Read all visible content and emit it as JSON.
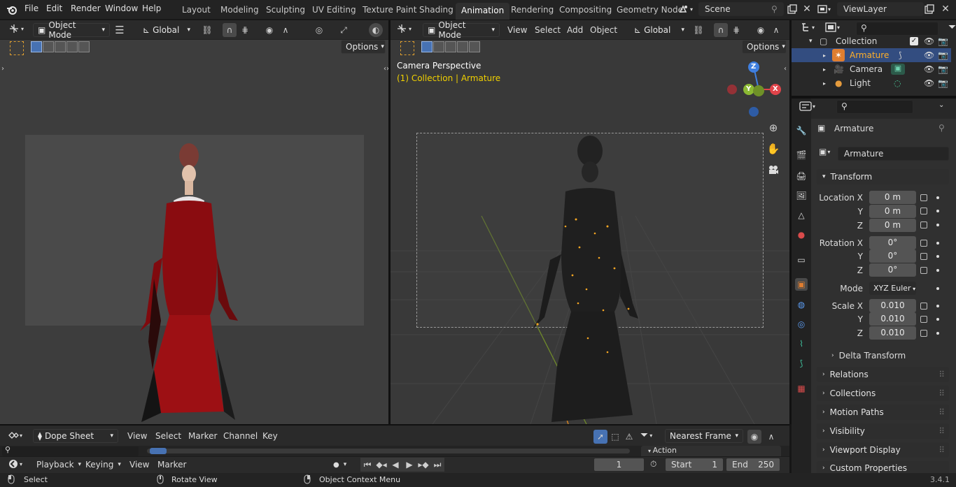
{
  "menu": {
    "file": "File",
    "edit": "Edit",
    "render": "Render",
    "window": "Window",
    "help": "Help"
  },
  "workspaces": [
    "Layout",
    "Modeling",
    "Sculpting",
    "UV Editing",
    "Texture Paint",
    "Shading",
    "Animation",
    "Rendering",
    "Compositing",
    "Geometry Node"
  ],
  "active_workspace": "Animation",
  "scene": {
    "name": "Scene"
  },
  "view_layer": {
    "name": "ViewLayer"
  },
  "left_viewport": {
    "mode": "Object Mode",
    "orientation": "Global",
    "options": "Options"
  },
  "right_viewport": {
    "mode": "Object Mode",
    "menus": [
      "View",
      "Select",
      "Add",
      "Object"
    ],
    "orientation": "Global",
    "options": "Options",
    "overlay_title": "Camera Perspective",
    "overlay_sub": "(1) Collection | Armature",
    "gizmo": {
      "z": "Z",
      "y": "Y",
      "x": "X"
    }
  },
  "outliner": {
    "collection": "Collection",
    "items": [
      {
        "name": "Armature",
        "selected": true
      },
      {
        "name": "Camera",
        "selected": false
      },
      {
        "name": "Light",
        "selected": false
      }
    ]
  },
  "properties": {
    "object_name": "Armature",
    "data_name": "Armature",
    "transform": "Transform",
    "location_label": "Location X",
    "loc_x": "0 m",
    "loc_y": "0 m",
    "loc_z": "0 m",
    "rotation_label": "Rotation X",
    "rot_x": "0°",
    "rot_y": "0°",
    "rot_z": "0°",
    "mode_label": "Mode",
    "mode_value": "XYZ Euler",
    "scale_label": "Scale X",
    "scale_x": "0.010",
    "scale_y": "0.010",
    "scale_z": "0.010",
    "y_label": "Y",
    "z_label": "Z",
    "delta": "Delta Transform",
    "panels": [
      "Relations",
      "Collections",
      "Motion Paths",
      "Visibility",
      "Viewport Display",
      "Custom Properties"
    ]
  },
  "dopesheet": {
    "mode": "Dope Sheet",
    "menus": [
      "View",
      "Select",
      "Marker",
      "Channel",
      "Key"
    ],
    "snap": "Nearest Frame",
    "action_label": "Action"
  },
  "timeline": {
    "playback": "Playback",
    "keying": "Keying",
    "view": "View",
    "marker": "Marker",
    "current_frame": "1",
    "start_label": "Start",
    "start": "1",
    "end_label": "End",
    "end": "250"
  },
  "status": {
    "select": "Select",
    "rotate": "Rotate View",
    "context": "Object Context Menu",
    "version": "3.4.1"
  },
  "colors": {
    "accent": "#4772b3",
    "selection_orange": "#f5a623",
    "gizmo_x": "#e0444a",
    "gizmo_y": "#8bb933",
    "gizmo_z": "#3f7fe0",
    "yellow_text": "#f0d000"
  }
}
